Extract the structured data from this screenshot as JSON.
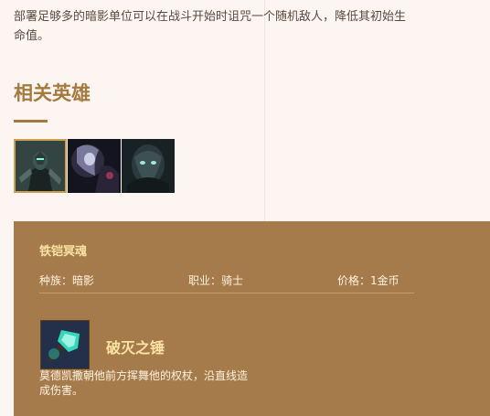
{
  "description": "部署足够多的暗影单位可以在战斗开始时诅咒一个随机敌人，降低其初始生命值。",
  "related_heroes": {
    "title": "相关英雄",
    "heroes": [
      {
        "icon": "armored-knight-portrait",
        "selected": true
      },
      {
        "icon": "shadow-mage-portrait",
        "selected": false
      },
      {
        "icon": "wraith-portrait",
        "selected": false
      }
    ]
  },
  "hero_card": {
    "name": "铁铠冥魂",
    "race": "种族：暗影",
    "class": "职业：骑士",
    "price": "价格：1金币",
    "item": {
      "icon": "hammer-icon",
      "name": "破灭之锤",
      "description": "莫德凯撒朝他前方挥舞他的权杖，沿直线造成伤害。"
    }
  },
  "colors": {
    "background": "#fdf5f1",
    "accent": "#a57a3f",
    "card": "#a67b4b",
    "card_title": "#fbe3a2"
  }
}
